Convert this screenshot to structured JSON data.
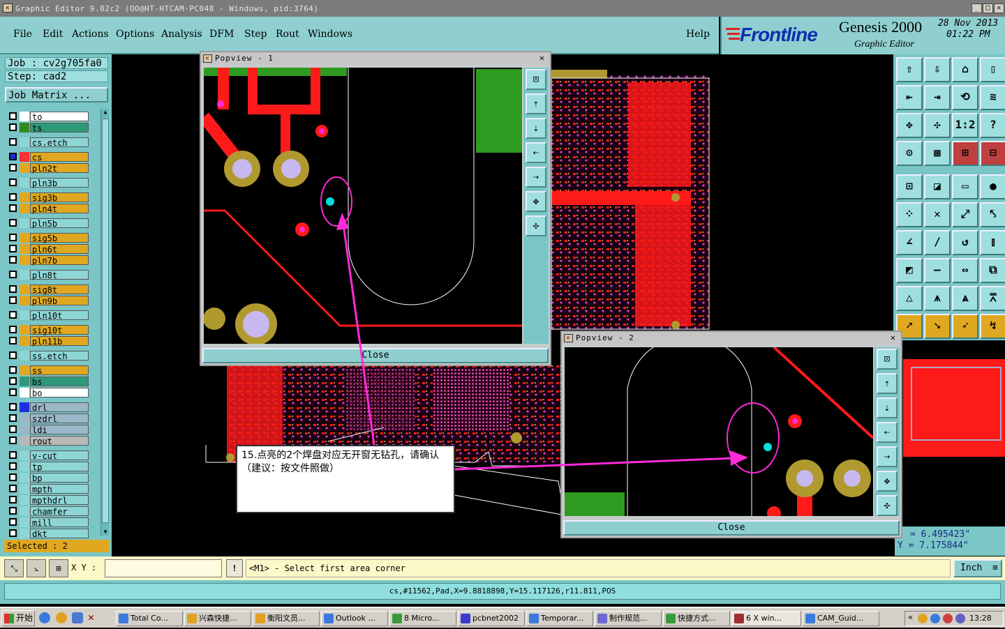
{
  "window": {
    "title": "Graphic Editor 9.02c2  (OO@HT-HTCAM-PC048 - Windows, pid:3764)"
  },
  "menu": {
    "items": [
      "File",
      "Edit",
      "Actions",
      "Options",
      "Analysis",
      "DFM",
      "Step",
      "Rout",
      "Windows"
    ],
    "help": "Help"
  },
  "brand": {
    "logo": "Frontline",
    "product": "Genesis 2000",
    "subtitle": "Graphic Editor",
    "date": "28 Nov 2013",
    "time": "01:22 PM"
  },
  "job": {
    "job_label": "Job : cv2g705fa0",
    "step_label": "Step: cad2",
    "matrix_button": "Job Matrix ..."
  },
  "layers": [
    {
      "name": "to",
      "color": "#ffffff",
      "flag": ""
    },
    {
      "name": "ts",
      "color": "#2e9a7a",
      "flag": "#2e8b20"
    },
    {
      "name": "cs.etch",
      "color": "#8ed6d6",
      "flag": ""
    },
    {
      "name": "cs",
      "color": "#e0a820",
      "flag": "#ff3030",
      "active": true
    },
    {
      "name": "pln2t",
      "color": "#e0a820",
      "flag": ""
    },
    {
      "name": "pln3b",
      "color": "#8ed6d6",
      "flag": ""
    },
    {
      "name": "sig3b",
      "color": "#e0a820",
      "flag": ""
    },
    {
      "name": "pln4t",
      "color": "#e0a820",
      "flag": ""
    },
    {
      "name": "pln5b",
      "color": "#8ed6d6",
      "flag": ""
    },
    {
      "name": "sig5b",
      "color": "#e0a820",
      "flag": ""
    },
    {
      "name": "pln6t",
      "color": "#e0a820",
      "flag": ""
    },
    {
      "name": "pln7b",
      "color": "#e0a820",
      "flag": ""
    },
    {
      "name": "pln8t",
      "color": "#8ed6d6",
      "flag": ""
    },
    {
      "name": "sig8t",
      "color": "#e0a820",
      "flag": ""
    },
    {
      "name": "pln9b",
      "color": "#e0a820",
      "flag": ""
    },
    {
      "name": "pln10t",
      "color": "#8ed6d6",
      "flag": ""
    },
    {
      "name": "sig10t",
      "color": "#e0a820",
      "flag": ""
    },
    {
      "name": "pln11b",
      "color": "#e0a820",
      "flag": ""
    },
    {
      "name": "ss.etch",
      "color": "#8ed6d6",
      "flag": ""
    },
    {
      "name": "ss",
      "color": "#e0a820",
      "flag": ""
    },
    {
      "name": "bs",
      "color": "#2e9a7a",
      "flag": ""
    },
    {
      "name": "bo",
      "color": "#ffffff",
      "flag": ""
    },
    {
      "name": "drl",
      "color": "#9ab8c8",
      "flag": "#1a30e0"
    },
    {
      "name": "szdrl",
      "color": "#9ab8c8",
      "flag": ""
    },
    {
      "name": "ldi",
      "color": "#9ab8c8",
      "flag": ""
    },
    {
      "name": "rout",
      "color": "#b8b8b8",
      "flag": ""
    },
    {
      "name": "v-cut",
      "color": "#8ed6d6",
      "flag": ""
    },
    {
      "name": "tp",
      "color": "#8ed6d6",
      "flag": ""
    },
    {
      "name": "bp",
      "color": "#8ed6d6",
      "flag": ""
    },
    {
      "name": "mpth",
      "color": "#8ed6d6",
      "flag": ""
    },
    {
      "name": "mpthdrl",
      "color": "#8ed6d6",
      "flag": ""
    },
    {
      "name": "chamfer",
      "color": "#8ed6d6",
      "flag": ""
    },
    {
      "name": "mill",
      "color": "#8ed6d6",
      "flag": ""
    },
    {
      "name": "dkt",
      "color": "#8ed6d6",
      "flag": ""
    }
  ],
  "selected": "Selected : 2",
  "popview1": {
    "title": "Popview - 1",
    "close": "Close"
  },
  "popview2": {
    "title": "Popview - 2",
    "close": "Close"
  },
  "annotation": {
    "text": "15.点亮的2个焊盘对应无开窗无钻孔，请确认（建议：按文件照做）"
  },
  "coords": {
    "x": "= 6.495423\"",
    "y": "Y = 7.175844\""
  },
  "command": {
    "xy_label": "X Y :",
    "xy_value": "",
    "prompt": "<M1> - Select first area corner",
    "units": "Inch"
  },
  "status": {
    "text": "cs,#11562,Pad,X=9.8818898,Y=15.117126,r11.811,POS"
  },
  "taskbar": {
    "start": "开始",
    "tasks": [
      "Total Co...",
      "兴森快捷...",
      "衡阳文员...",
      "Outlook ...",
      "8 Micro...",
      "pcbnet2002",
      "Temporar...",
      "制作规范...",
      "快捷方式...",
      "6 X win...",
      "CAM_Guid..."
    ],
    "clock": "13:28"
  },
  "colors": {
    "accent": "#8fcfcf",
    "copper": "#ff1a1a",
    "pad": "#b09a30",
    "highlight": "#ff2ad8"
  }
}
